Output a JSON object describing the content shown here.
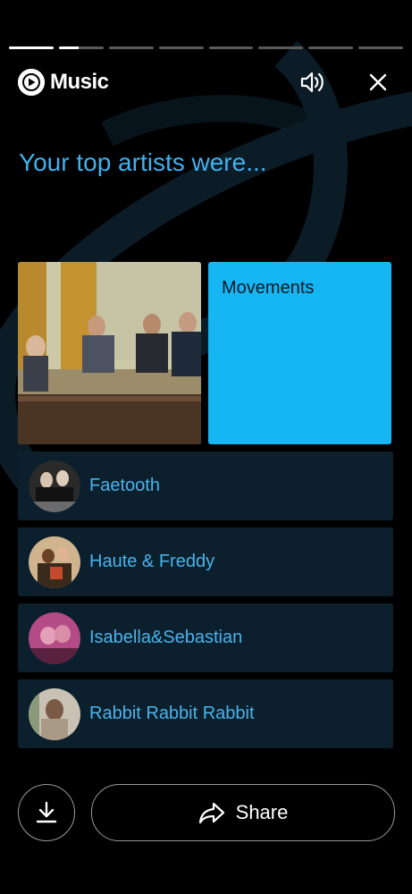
{
  "progress": {
    "segments": 8,
    "current": 2,
    "current_fill": 0.5
  },
  "header": {
    "logo_text": "Music",
    "logo_icon": "play-circle-icon",
    "sound_icon": "speaker-icon",
    "close_icon": "close-icon"
  },
  "headline": "Your top artists were...",
  "top_artist": {
    "name": "Movements",
    "card_color": "#16b5f3"
  },
  "artists": [
    {
      "name": "Faetooth"
    },
    {
      "name": "Haute & Freddy"
    },
    {
      "name": "Isabella&Sebastian"
    },
    {
      "name": "Rabbit Rabbit Rabbit"
    }
  ],
  "actions": {
    "download_icon": "download-icon",
    "share_label": "Share",
    "share_icon": "share-arrow-icon"
  },
  "colors": {
    "accent": "#3fb2ee",
    "row_bg": "#0b1f2c",
    "background": "#000000"
  }
}
